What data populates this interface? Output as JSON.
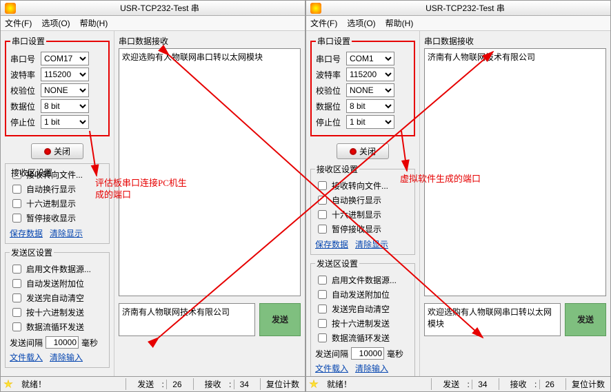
{
  "title": "USR-TCP232-Test 串",
  "menu": {
    "file": "文件(F)",
    "options": "选项(O)",
    "help": "帮助(H)"
  },
  "labels": {
    "serial_settings": "串口设置",
    "port": "串口号",
    "baud": "波特率",
    "parity": "校验位",
    "databits": "数据位",
    "stopbits": "停止位",
    "close": "关闭",
    "recv_settings": "接收区设置",
    "recv_to_file": "接收转向文件...",
    "auto_wrap": "自动换行显示",
    "hex_show": "十六进制显示",
    "pause_recv": "暂停接收显示",
    "save_data": "保存数据",
    "clear_show": "清除显示",
    "send_settings": "发送区设置",
    "file_src": "启用文件数据源...",
    "auto_append": "自动发送附加位",
    "auto_clear": "发送完自动清空",
    "hex_send": "按十六进制发送",
    "loop_send": "数据流循环发送",
    "interval_lbl": "发送间隔",
    "ms": "毫秒",
    "file_load": "文件载入",
    "clear_input": "清除输入",
    "recv_hdr": "串口数据接收",
    "send": "发送",
    "ready": "就绪！",
    "tx": "发送",
    "rx": "接收",
    "reset": "复位计数"
  },
  "left": {
    "port": "COM17",
    "baud": "115200",
    "parity": "NONE",
    "databits": "8 bit",
    "stopbits": "1 bit",
    "interval": "10000",
    "recv_text": "欢迎选购有人物联网串口转以太网模块",
    "send_text": "济南有人物联网技术有限公司",
    "tx": "26",
    "rx": "34",
    "anno": "评估板串口连接PC机生成的端口"
  },
  "right": {
    "port": "COM1",
    "baud": "115200",
    "parity": "NONE",
    "databits": "8 bit",
    "stopbits": "1 bit",
    "interval": "10000",
    "recv_text": "济南有人物联网技术有限公司",
    "send_text": "欢迎选购有人物联网串口转以太网模块",
    "tx": "34",
    "rx": "26",
    "anno": "虚拟软件生成的端口"
  }
}
